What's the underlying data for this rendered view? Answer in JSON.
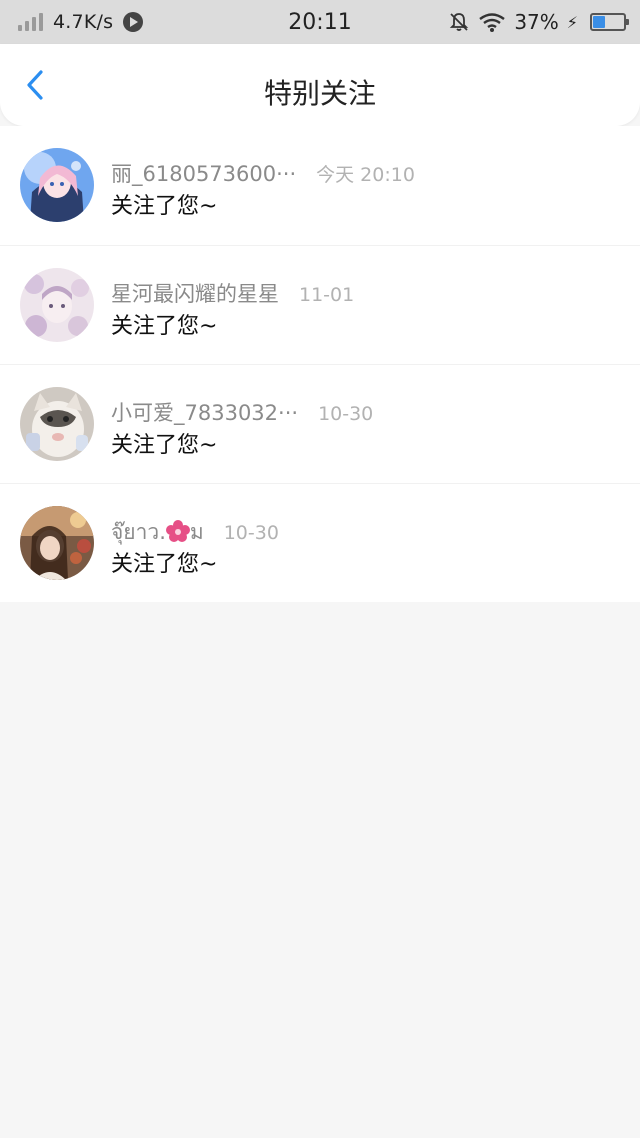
{
  "status_bar": {
    "net_speed": "4.7K/s",
    "time": "20:11",
    "battery_percent": "37%",
    "battery_level": 0.37,
    "icons": [
      "signal-icon",
      "play-icon",
      "mute-bell-icon",
      "wifi-icon",
      "charging-icon",
      "battery-icon"
    ]
  },
  "nav": {
    "title": "特别关注",
    "back_icon": "chevron-left-icon",
    "accent": "#2b8ef0"
  },
  "notifications": [
    {
      "name": "丽_6180573600···",
      "time": "今天 20:10",
      "message": "关注了您~"
    },
    {
      "name": "星河最闪耀的星星",
      "time": "11-01",
      "message": "关注了您~"
    },
    {
      "name": "小可爱_7833032···",
      "time": "10-30",
      "message": "关注了您~"
    },
    {
      "name_prefix": "จุ๊ยาว.",
      "name_suffix": "ม",
      "name_icon": "flower-icon",
      "time": "10-30",
      "message": "关注了您~"
    }
  ]
}
